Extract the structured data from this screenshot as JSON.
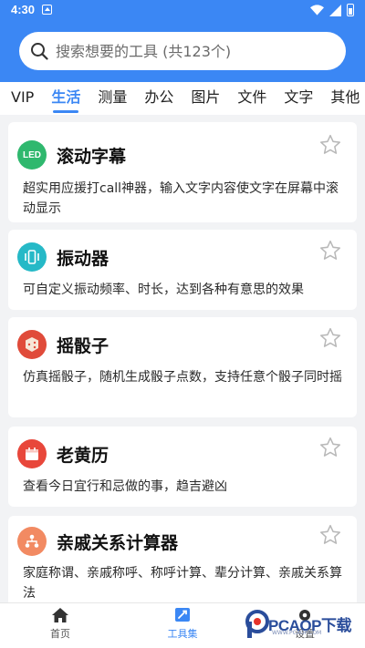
{
  "status_bar": {
    "time": "4:30"
  },
  "search": {
    "placeholder": "搜索想要的工具 (共123个)"
  },
  "tabs": [
    {
      "label": "VIP"
    },
    {
      "label": "生活",
      "active": true
    },
    {
      "label": "测量"
    },
    {
      "label": "办公"
    },
    {
      "label": "图片"
    },
    {
      "label": "文件"
    },
    {
      "label": "文字"
    },
    {
      "label": "其他"
    }
  ],
  "tools": [
    {
      "title": "滚动字幕",
      "description": "超实用应援打call神器，输入文字内容使文字在屏幕中滚动显示",
      "icon": "led-icon",
      "icon_text": "LED",
      "icon_color": "#2fb86e",
      "favorited": false
    },
    {
      "title": "振动器",
      "description": "可自定义振动频率、时长，达到各种有意思的效果",
      "icon": "vibration-icon",
      "icon_color": "#26b9c7",
      "favorited": false
    },
    {
      "title": "摇骰子",
      "description": "仿真摇骰子，随机生成骰子点数，支持任意个骰子同时摇",
      "icon": "dice-icon",
      "icon_color": "#e04b3a",
      "favorited": false
    },
    {
      "title": "老黄历",
      "description": "查看今日宜行和忌做的事，趋吉避凶",
      "icon": "calendar-icon",
      "icon_color": "#e8473b",
      "favorited": false
    },
    {
      "title": "亲戚关系计算器",
      "description": "家庭称谓、亲戚称呼、称呼计算、辈分计算、亲戚关系算法",
      "icon": "family-tree-icon",
      "icon_color": "#f28a62",
      "favorited": false
    }
  ],
  "bottom_nav": [
    {
      "label": "首页",
      "icon": "home-icon",
      "active": false
    },
    {
      "label": "工具集",
      "icon": "toolkit-icon",
      "active": true
    },
    {
      "label": "设置",
      "icon": "settings-icon",
      "active": false
    }
  ],
  "watermark": {
    "text": "PCAOP下载",
    "subtext": "WWW.PCAOP.COM"
  },
  "colors": {
    "primary": "#3b87f4",
    "background": "#f2f3f5",
    "card": "#ffffff"
  }
}
